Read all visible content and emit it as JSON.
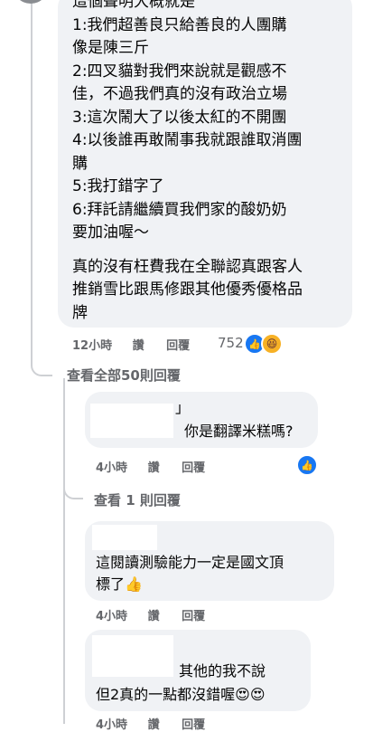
{
  "main_comment": {
    "lines": [
      "這個聲明大概就是",
      "1:我們超善良只給善良的人團購",
      "像是陳三斤",
      "2:四叉貓對我們來說就是觀感不",
      "佳，不過我們真的沒有政治立場",
      "3:這次鬧大了以後太紅的不開團",
      "4:以後誰再敢鬧事我就跟誰取消團",
      "購",
      "5:我打錯字了",
      "6:拜託請繼續買我們家的酸奶奶",
      "要加油喔～"
    ],
    "lines_2": [
      "真的沒有枉費我在全聯認真跟客人",
      "推銷雪比跟馬修跟其他優秀優格品",
      "牌"
    ],
    "time": "12小時",
    "like_label": "讚",
    "reply_label": "回覆",
    "reaction_count": "752"
  },
  "view_all_replies": "查看全部50則回覆",
  "reply1": {
    "prefix": "」",
    "text": "你是翻譯米糕嗎?",
    "time": "4小時",
    "like_label": "讚",
    "reply_label": "回覆",
    "view_more": "查看 1 則回覆"
  },
  "reply2": {
    "lines": [
      "這閱讀測驗能力一定是國文頂",
      "標了👍"
    ],
    "time": "4小時",
    "like_label": "讚",
    "reply_label": "回覆"
  },
  "reply3": {
    "lines": [
      "其他的我不說",
      "但2真的一點都沒錯喔😍😍"
    ],
    "time": "4小時",
    "like_label": "讚",
    "reply_label": "回覆"
  }
}
